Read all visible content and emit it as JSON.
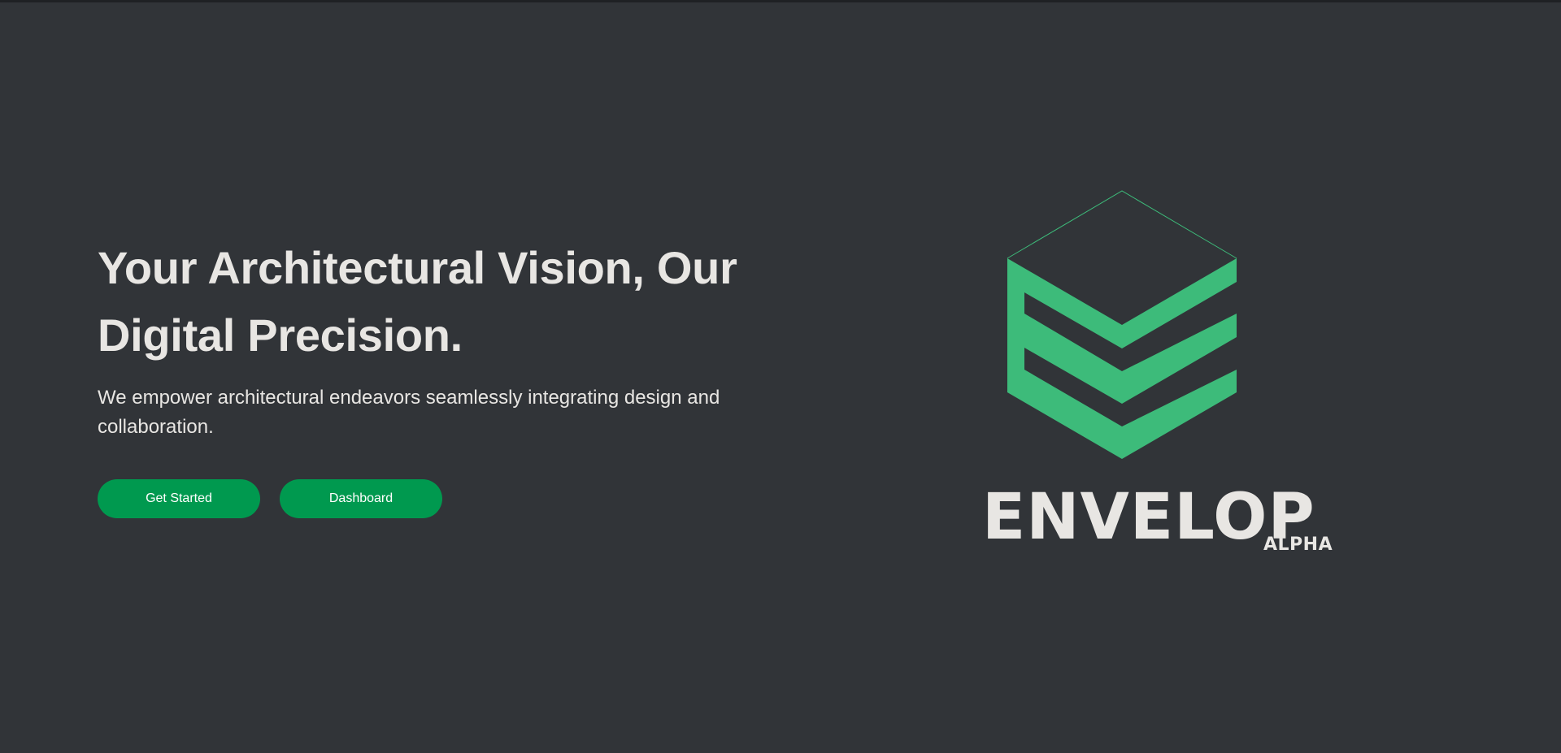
{
  "hero": {
    "headline_line1": "Your Architectural Vision, Our",
    "headline_line2": "Digital Precision.",
    "subtext": "We empower architectural endeavors seamlessly integrating design and collaboration.",
    "buttons": {
      "get_started": "Get Started",
      "dashboard": "Dashboard"
    }
  },
  "logo": {
    "name": "ENVELOP",
    "badge": "ALPHA",
    "icon": "envelop-cube-logo",
    "accent_color": "#3dbb7a"
  },
  "colors": {
    "background": "#313438",
    "text": "#e8e6e3",
    "button": "#00994f"
  }
}
